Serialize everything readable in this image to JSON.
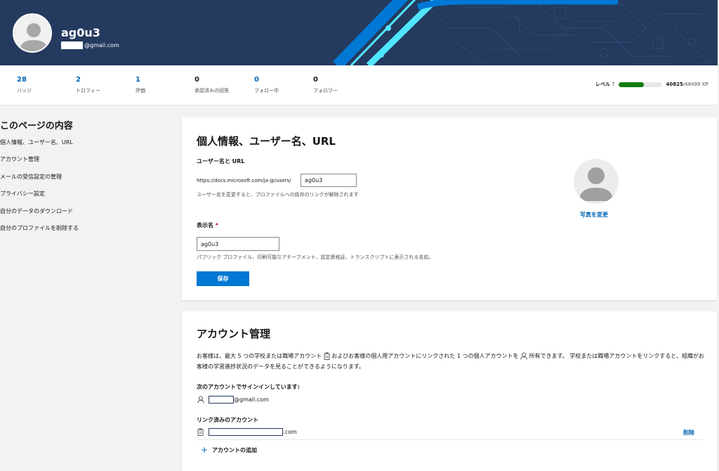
{
  "header": {
    "name": "ag0u3",
    "email_suffix": "@gmail.com",
    "colors": {
      "banner": "#243a5e",
      "accent_cyan": "#50e6ff",
      "accent_blue": "#0078d4"
    }
  },
  "stats": [
    {
      "value": "28",
      "label": "バッジ"
    },
    {
      "value": "2",
      "label": "トロフィー"
    },
    {
      "value": "1",
      "label": "評価"
    },
    {
      "value": "0",
      "label": "承認済みの回答"
    },
    {
      "value": "0",
      "label": "フォロー中"
    },
    {
      "value": "0",
      "label": "フォロワー"
    }
  ],
  "level": {
    "label": "レベル",
    "number": "7",
    "xp_current": "40825",
    "xp_total": "/48499 XP",
    "progress_fraction": 0.58
  },
  "toc": {
    "title": "このページの内容",
    "items": [
      "個人情報、ユーザー名、URL",
      "アカウント管理",
      "メールの受信設定の管理",
      "プライバシー設定",
      "自分のデータのダウンロード",
      "自分のプロファイルを削除する"
    ]
  },
  "personal": {
    "heading": "個人情報、ユーザー名、URL",
    "username_heading": "ユーザー名と URL",
    "url_prefix": "https://docs.microsoft.com/ja-jp/users/",
    "username_value": "ag0u3",
    "username_help": "ユーザー名を変更すると、プロファイルへの既存のリンクが解除されます",
    "change_photo": "写真を変更",
    "display_name_label": "表示名",
    "required_mark": "*",
    "display_name_value": "ag0u3",
    "display_name_help": "パブリック プロファイル、印刷可能なアチーブメント、認定資格証、トランスクリプトに表示される名前。",
    "save": "保存"
  },
  "account": {
    "heading": "アカウント管理",
    "desc_part1": "お客様は、最大 5 つの学校または職場アカウント",
    "desc_part2": "およびお客様の個人用アカウントにリンクされた 1 つの個人アカウントを",
    "desc_part3": "所有できます。 学校または職場アカウン",
    "desc_part4": "トをリンクすると、組織がお客様の学習進捗状況のデータを見ることができるようになります。",
    "signed_in_heading": "次のアカウントでサインインしています:",
    "signed_in_suffix": "@gmail.com",
    "linked_heading": "リンク済みのアカウント",
    "linked_suffix": ".com",
    "delete": "削除",
    "add": "アカウントの追加"
  }
}
